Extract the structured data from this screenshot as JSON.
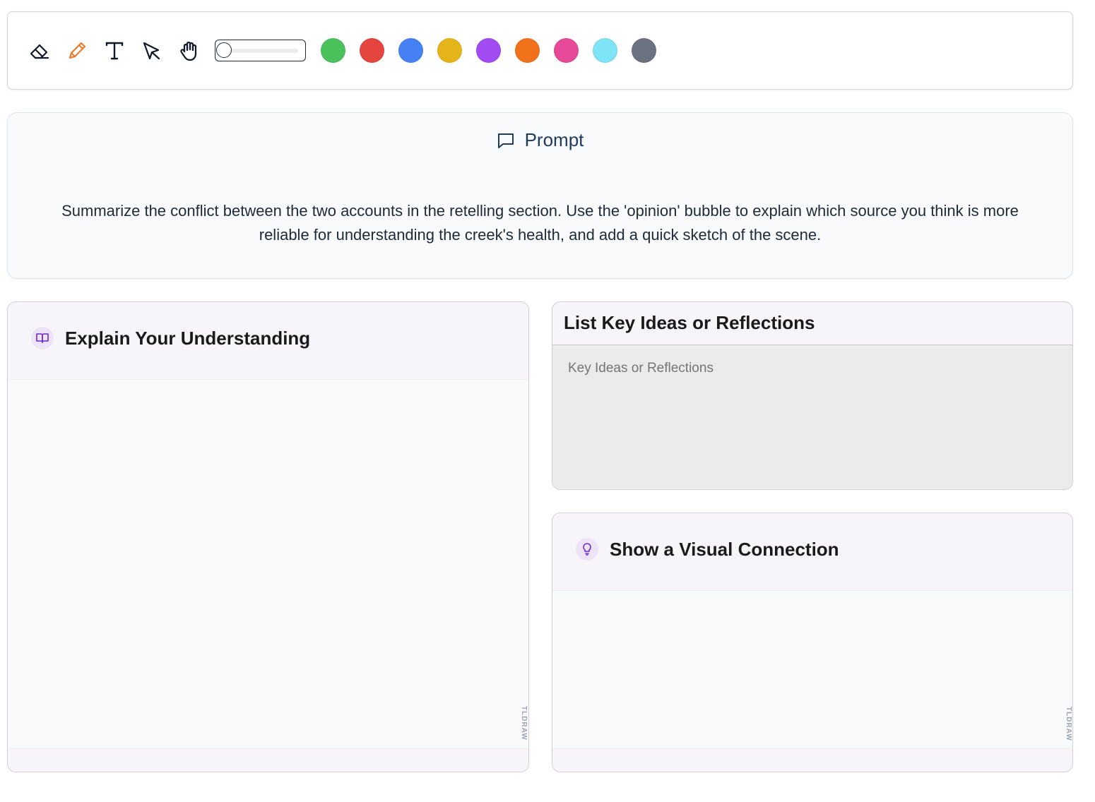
{
  "toolbar": {
    "tools": [
      {
        "name": "eraser",
        "icon": "eraser-icon",
        "color": "#111827"
      },
      {
        "name": "pencil",
        "icon": "pencil-icon",
        "color": "#ea7c2b"
      },
      {
        "name": "text",
        "icon": "text-icon",
        "color": "#111827"
      },
      {
        "name": "select",
        "icon": "cursor-icon",
        "color": "#111827"
      },
      {
        "name": "hand",
        "icon": "hand-icon",
        "color": "#111827"
      }
    ],
    "stroke_size": 0,
    "colors": [
      "#4bc15c",
      "#e5453f",
      "#4680f5",
      "#e5b418",
      "#a14bf2",
      "#f1711a",
      "#e54998",
      "#7ee3f4",
      "#6b7280"
    ]
  },
  "prompt": {
    "title": "Prompt",
    "text": "Summarize the conflict between the two accounts in the retelling section. Use the 'opinion' bubble to explain which source you think is more reliable for understanding the creek's health, and add a quick sketch of the scene."
  },
  "explain": {
    "title": "Explain Your Understanding",
    "watermark": "TLDRAW"
  },
  "key_ideas": {
    "title": "List Key Ideas or Reflections",
    "placeholder": "Key Ideas or Reflections",
    "value": ""
  },
  "visual": {
    "title": "Show a Visual Connection",
    "watermark": "TLDRAW"
  }
}
